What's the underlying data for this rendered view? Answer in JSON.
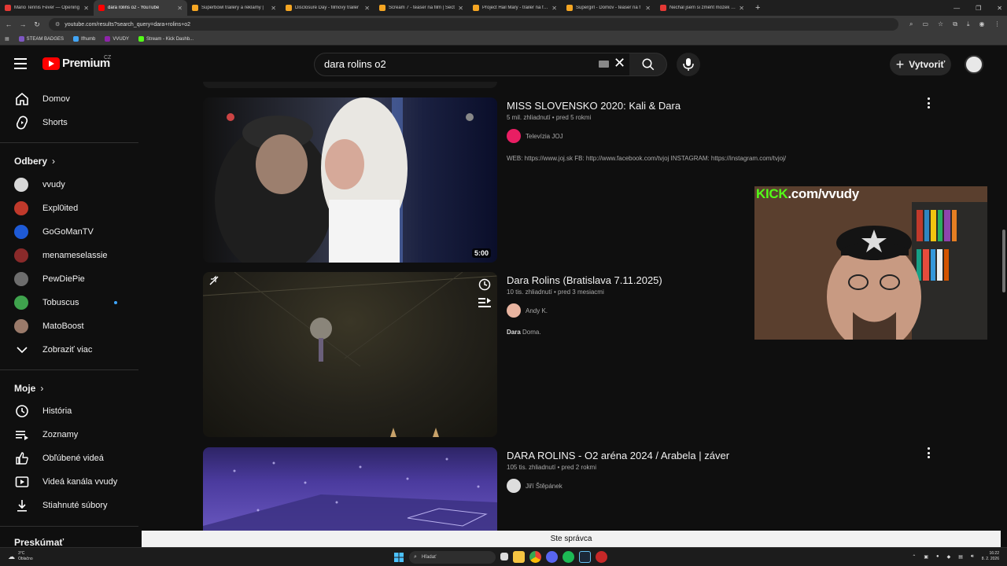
{
  "browser": {
    "tabs": [
      {
        "title": "Mario Tennis Fever — Opening",
        "color": "#e53935",
        "active": false
      },
      {
        "title": "dara rolins o2 - YouTube",
        "color": "#ff0000",
        "active": true
      },
      {
        "title": "Superbowl trailery a reklamy |",
        "color": "#f5a623",
        "active": false
      },
      {
        "title": "Disclosure Day - filmový trailer",
        "color": "#f5a623",
        "active": false
      },
      {
        "title": "Scream 7 - teaser na film | Sect",
        "color": "#f5a623",
        "active": false
      },
      {
        "title": "Project Hail Mary - trailer na film",
        "color": "#f5a623",
        "active": false
      },
      {
        "title": "Supergirl - Domov - teaser na f",
        "color": "#f5a623",
        "active": false
      },
      {
        "title": "Nechal jsem si změřit mozek na",
        "color": "#e53935",
        "active": false
      }
    ],
    "url": "youtube.com/results?search_query=dara+rolins+o2",
    "bookmarks": [
      {
        "label": "STEAM BADGES",
        "color": "#7e57c2"
      },
      {
        "label": "Ifhumb",
        "color": "#42a5f5"
      },
      {
        "label": "VVUDY",
        "color": "#8e24aa"
      },
      {
        "label": "Stream - Kick Dashb...",
        "color": "#53fc18"
      }
    ]
  },
  "header": {
    "logo_text": "Premium",
    "country_code": "CZ",
    "search_query": "dara rolins o2",
    "create_label": "Vytvoriť"
  },
  "sidebar": {
    "main": [
      {
        "label": "Domov",
        "icon": "home-icon"
      },
      {
        "label": "Shorts",
        "icon": "shorts-icon"
      }
    ],
    "subscriptions_title": "Odbery",
    "subscriptions": [
      {
        "label": "vvudy",
        "color": "#d8d8d8",
        "live": false
      },
      {
        "label": "Expl0ited",
        "color": "#c0392b",
        "live": false
      },
      {
        "label": "GoGoManTV",
        "color": "#1e5ad6",
        "live": false
      },
      {
        "label": "menameselassie",
        "color": "#8a2a2a",
        "live": false
      },
      {
        "label": "PewDiePie",
        "color": "#6d6d6d",
        "live": false
      },
      {
        "label": "Tobuscus",
        "color": "#3fa34d",
        "live": true
      },
      {
        "label": "MatoBoost",
        "color": "#9a7a6a",
        "live": false
      }
    ],
    "show_more": "Zobraziť viac",
    "you_title": "Moje",
    "you_items": [
      {
        "label": "História",
        "icon": "history-icon"
      },
      {
        "label": "Zoznamy",
        "icon": "playlists-icon"
      },
      {
        "label": "Obľúbené videá",
        "icon": "liked-icon"
      },
      {
        "label": "Videá kanála vvudy",
        "icon": "your-videos-icon"
      },
      {
        "label": "Stiahnuté súbory",
        "icon": "downloads-icon"
      }
    ],
    "explore_title": "Preskúmať"
  },
  "results": [
    {
      "title": "MISS SLOVENSKO 2020: Kali & Dara",
      "meta": "5 mil. zhliadnutí • pred 5 rokmi",
      "channel": "Televízia JOJ",
      "channel_color": "#e91e63",
      "desc_bold": "",
      "desc": "WEB: https://www.joj.sk FB: http://www.facebook.com/tvjoj INSTAGRAM: https://instagram.com/tvjoj/",
      "duration": "5:00"
    },
    {
      "title": "Dara Rolins (Bratislava 7.11.2025)",
      "meta": "10 tis. zhliadnutí • pred 3 mesiacmi",
      "channel": "Andy K.",
      "channel_color": "#e8b4a0",
      "desc_bold": "Dara",
      "desc": " Doma.",
      "duration": ""
    },
    {
      "title": "DARA ROLINS - O2 aréna 2024 / Arabela | záver",
      "meta": "105 tis. zhliadnutí • pred 2 rokmi",
      "channel": "Jiří Štěpánek",
      "channel_color": "#dddddd",
      "desc_bold": "",
      "desc": "",
      "duration": ""
    }
  ],
  "overlay": {
    "kick_brand": "KICK",
    "kick_suffix": ".com/vvudy"
  },
  "banner": {
    "text": "Ste správca"
  },
  "taskbar": {
    "temp": "3°C",
    "weather": "Oblačno",
    "search_placeholder": "Hľadať",
    "time": "16:22",
    "date": "8. 2. 2026"
  }
}
